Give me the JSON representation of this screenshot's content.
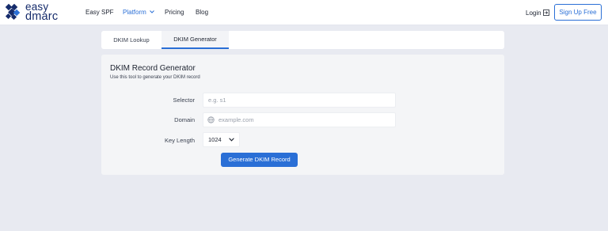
{
  "brand": {
    "line1": "easy",
    "line2": "dmarc"
  },
  "nav": {
    "items": [
      {
        "label": "Easy SPF"
      },
      {
        "label": "Platform",
        "has_dropdown": true,
        "active": true
      },
      {
        "label": "Pricing"
      },
      {
        "label": "Blog"
      }
    ],
    "login_label": "Login",
    "signup_label": "Sign Up Free"
  },
  "tabs": [
    {
      "label": "DKIM Lookup",
      "active": false
    },
    {
      "label": "DKIM Generator",
      "active": true
    }
  ],
  "form": {
    "title": "DKIM Record Generator",
    "subtitle": "Use this tool to generate your DKIM record",
    "selector": {
      "label": "Selector",
      "placeholder": "e.g. s1",
      "value": ""
    },
    "domain": {
      "label": "Domain",
      "placeholder": "example.com",
      "value": "",
      "icon": "globe-icon"
    },
    "key_length": {
      "label": "Key Length",
      "value": "1024"
    },
    "submit_label": "Generate DKIM Record"
  },
  "colors": {
    "accent": "#2a6fd6",
    "brand": "#152b6b",
    "page_bg": "#e8eaf1",
    "card_bg": "#f4f5f7"
  }
}
